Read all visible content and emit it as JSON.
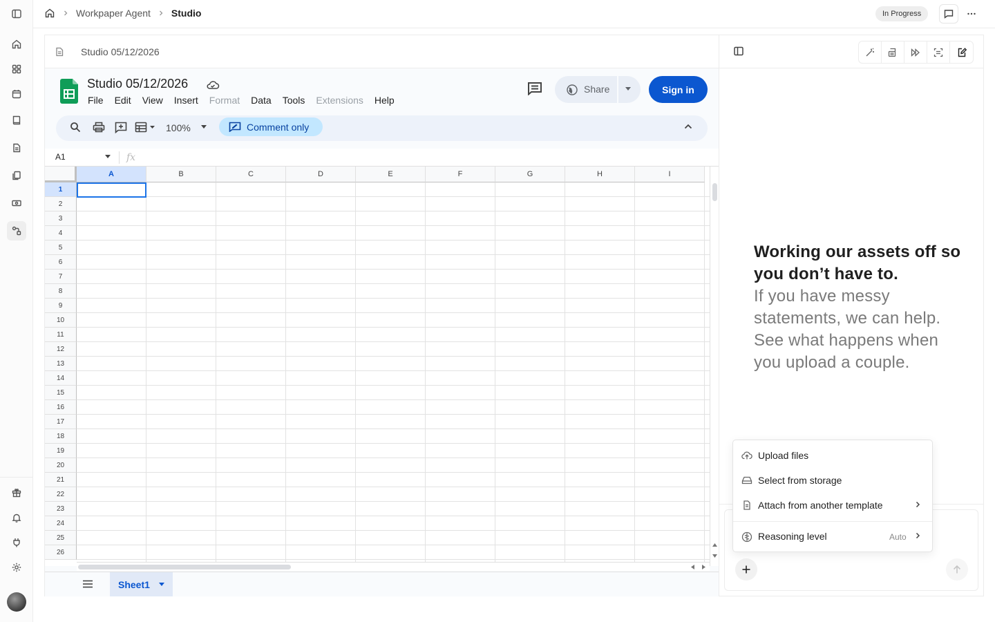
{
  "breadcrumb": {
    "home_icon": "home-icon",
    "item1": "Workpaper Agent",
    "item2": "Studio"
  },
  "status": {
    "label": "In Progress"
  },
  "document": {
    "title": "Studio 05/12/2026"
  },
  "sheets": {
    "title": "Studio 05/12/2026",
    "menu": [
      "File",
      "Edit",
      "View",
      "Insert",
      "Format",
      "Data",
      "Tools",
      "Extensions",
      "Help"
    ],
    "menu_disabled": [
      "Format",
      "Extensions"
    ],
    "share_label": "Share",
    "signin_label": "Sign in",
    "zoom": "100%",
    "comment_only": "Comment only",
    "name_box": "A1",
    "fx": "fx",
    "columns": [
      "A",
      "B",
      "C",
      "D",
      "E",
      "F",
      "G",
      "H",
      "I"
    ],
    "rows": [
      "1",
      "2",
      "3",
      "4",
      "5",
      "6",
      "7",
      "8",
      "9",
      "10",
      "11",
      "12",
      "13",
      "14",
      "15",
      "16",
      "17",
      "18",
      "19",
      "20",
      "21",
      "22",
      "23",
      "24",
      "25",
      "26"
    ],
    "selected_cell": "A1",
    "sheet_tab": "Sheet1",
    "brand_color": "#0f9d58",
    "accent_color": "#0b57d0"
  },
  "assistant": {
    "headline": "Working our assets off so you don’t have to.",
    "subtext": "If you have messy statements, we can help. See what happens when you upload a couple."
  },
  "attach_menu": {
    "upload": "Upload files",
    "storage": "Select from storage",
    "template": "Attach from another template",
    "reasoning": "Reasoning level",
    "reasoning_value": "Auto"
  }
}
